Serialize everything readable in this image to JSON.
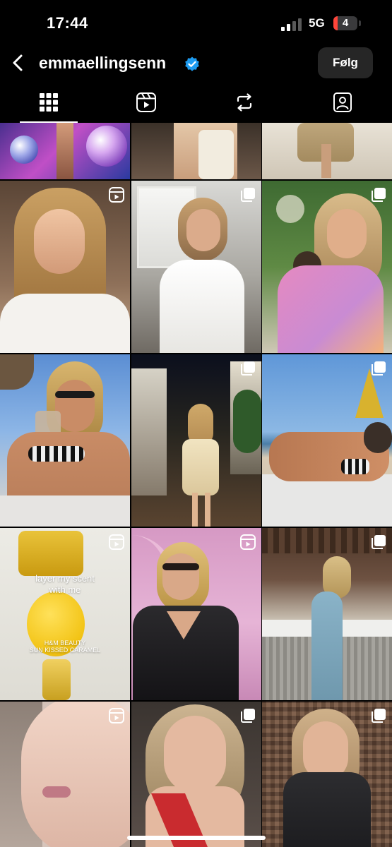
{
  "status": {
    "time": "17:44",
    "network": "5G",
    "battery": "4"
  },
  "header": {
    "username": "emmaellingsenn",
    "follow_label": "Følg"
  },
  "tabs": [
    {
      "name": "posts-grid",
      "icon": "grid-icon",
      "active": true
    },
    {
      "name": "reels",
      "icon": "reels-icon",
      "active": false
    },
    {
      "name": "reposts",
      "icon": "repost-icon",
      "active": false
    },
    {
      "name": "tagged",
      "icon": "tagged-icon",
      "active": false
    }
  ],
  "colors": {
    "background": "#000000",
    "verified": "#1d9bf0",
    "follow_button": "#262626",
    "battery_low": "#ff453a"
  },
  "tile_overlay": {
    "line1": "layer my scent",
    "line2": "with me",
    "brand": "H&M BEAUTY",
    "product": "SUN KISSED CARAMEL"
  },
  "grid_badges": [
    [
      "",
      "",
      ""
    ],
    [
      "reel-icon",
      "carousel-icon",
      "carousel-icon"
    ],
    [
      "",
      "carousel-icon",
      "carousel-icon"
    ],
    [
      "reel-icon",
      "reel-icon",
      "carousel-icon"
    ],
    [
      "reel-icon",
      "carousel-icon",
      "carousel-icon"
    ]
  ]
}
